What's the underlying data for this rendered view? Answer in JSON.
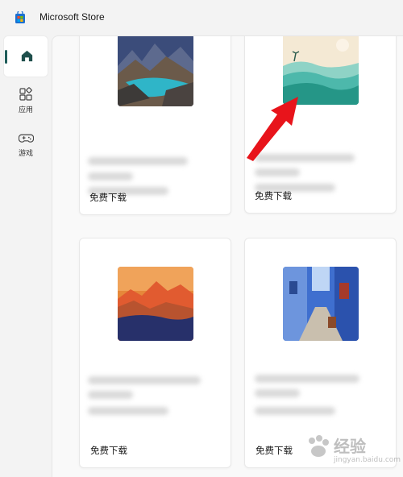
{
  "window": {
    "title": "Microsoft Store",
    "logo_icon": "microsoft-store-icon"
  },
  "sidebar": {
    "items": [
      {
        "label": "",
        "icon": "home-icon",
        "selected": true
      },
      {
        "label": "应用",
        "icon": "apps-icon",
        "selected": false
      },
      {
        "label": "游戏",
        "icon": "gamepad-icon",
        "selected": false
      }
    ],
    "accent_color": "#1f5c59"
  },
  "cards": [
    {
      "image": "mountain-lake-image",
      "title": "",
      "action_label": "免费下载"
    },
    {
      "image": "waves-landscape-image",
      "title": "",
      "action_label": "免费下载"
    },
    {
      "image": "sunset-peaks-image",
      "title": "",
      "action_label": "免费下载"
    },
    {
      "image": "blue-street-image",
      "title": "",
      "action_label": "免费下载"
    }
  ],
  "annotation": {
    "arrow_color": "#e8141b"
  },
  "watermark": {
    "text": "经验",
    "sub": "jingyan.baidu.com"
  }
}
